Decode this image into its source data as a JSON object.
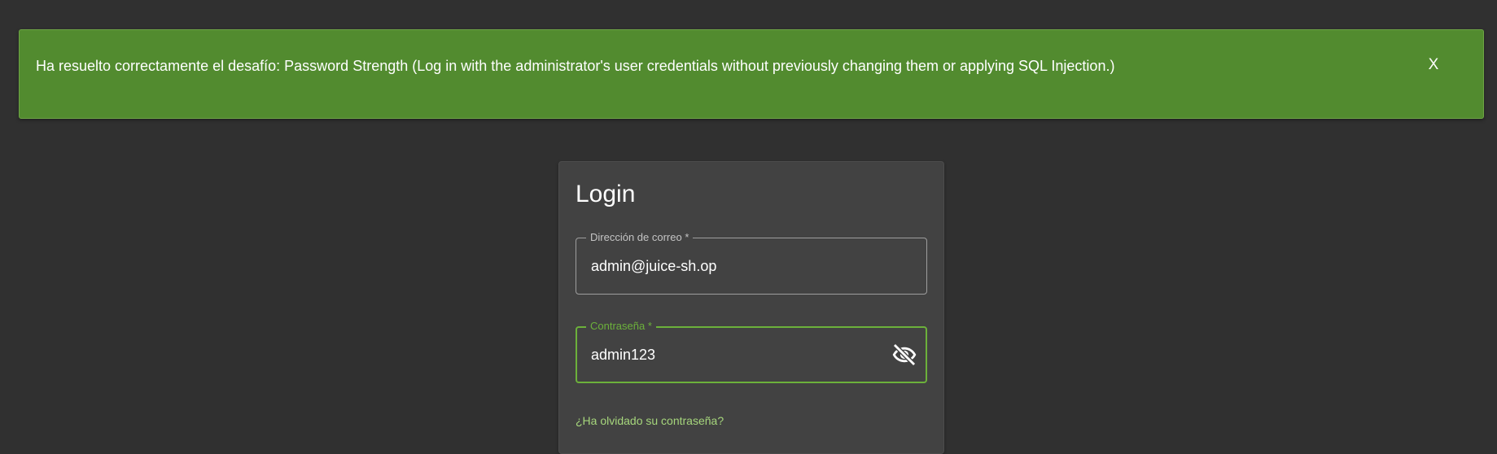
{
  "banner": {
    "message": "Ha resuelto correctamente el desafío: Password Strength (Log in with the administrator's user credentials without previously changing them or applying SQL Injection.)",
    "close_label": "X",
    "color": "#528b2f"
  },
  "login": {
    "title": "Login",
    "email": {
      "label": "Dirección de correo *",
      "value": "admin@juice-sh.op"
    },
    "password": {
      "label": "Contraseña *",
      "value": "admin123",
      "toggle_icon": "visibility-off-icon"
    },
    "forgot_link": "¿Ha olvidado su contraseña?",
    "accent_color": "#6cb13b"
  }
}
